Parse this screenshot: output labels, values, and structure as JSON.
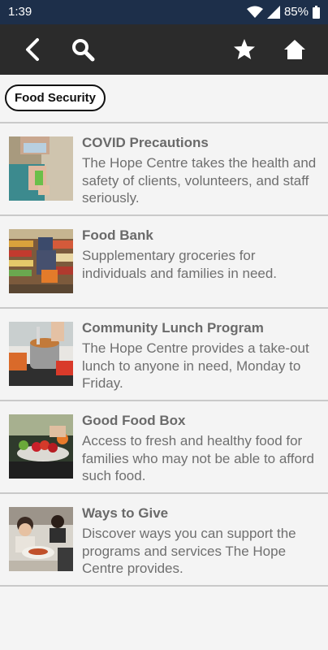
{
  "status": {
    "time": "1:39",
    "battery": "85%"
  },
  "app_bar": {
    "icons": [
      "back-icon",
      "search-icon",
      "star-icon",
      "home-icon"
    ]
  },
  "chip": {
    "label": "Food Security"
  },
  "items": [
    {
      "title": "COVID Precautions",
      "description": "The Hope Centre takes the health and safety of clients, volunteers, and staff seriously."
    },
    {
      "title": "Food Bank",
      "description": "Supplementary groceries for individuals and families in need."
    },
    {
      "title": "Community Lunch Program",
      "description": "The Hope Centre provides a take-out lunch to anyone in need, Monday to Friday."
    },
    {
      "title": "Good Food Box",
      "description": "Access to fresh and healthy food for families who may not be able to afford such food."
    },
    {
      "title": "Ways to Give",
      "description": "Discover ways you can support the programs and services The Hope Centre provides."
    }
  ],
  "colors": {
    "status_bar": "#1d2f4a",
    "app_bar": "#2b2b2b",
    "background": "#f4f4f4",
    "divider": "#c9c9c9"
  }
}
